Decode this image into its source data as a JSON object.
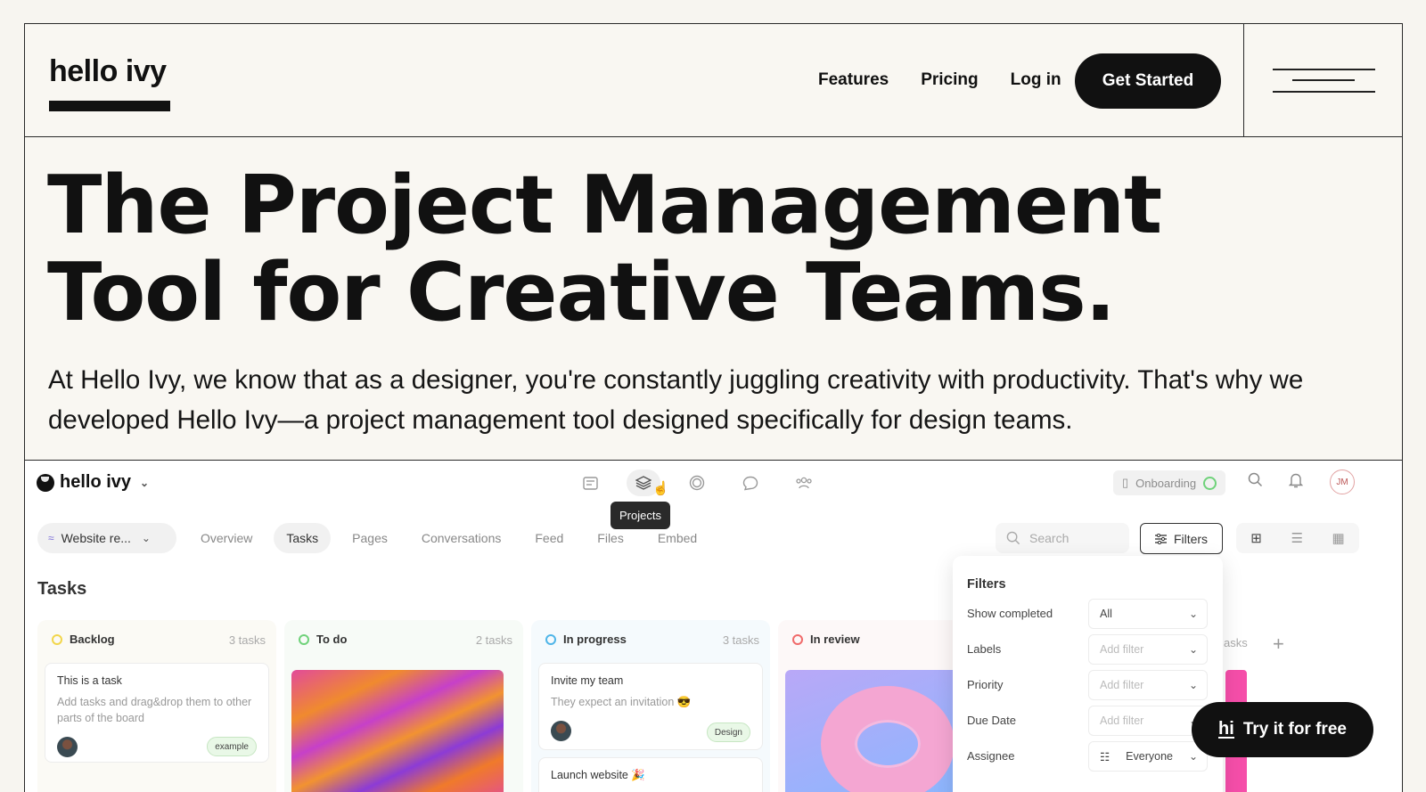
{
  "header": {
    "logo": "hello ivy",
    "nav": [
      "Features",
      "Pricing",
      "Log in"
    ],
    "cta": "Get Started"
  },
  "hero": {
    "title_line1": "The Project Management",
    "title_line2": "Tool for Creative Teams.",
    "lede": "At Hello Ivy, we know that as a designer, you're constantly juggling creativity with productivity. That's why we developed Hello Ivy—a project management tool designed specifically for design teams."
  },
  "app": {
    "logo": "hello ivy",
    "tooltip": "Projects",
    "onboarding": "Onboarding",
    "avatar_initials": "JM",
    "project": "Website re...",
    "tabs": [
      "Overview",
      "Tasks",
      "Pages",
      "Conversations",
      "Feed",
      "Files",
      "Embed"
    ],
    "active_tab": "Tasks",
    "search_placeholder": "Search",
    "filters_label": "Filters",
    "section_title": "Tasks",
    "columns": [
      {
        "name": "Backlog",
        "count": "3 tasks",
        "color": "#f2d64b"
      },
      {
        "name": "To do",
        "count": "2 tasks",
        "color": "#6fd27a"
      },
      {
        "name": "In progress",
        "count": "3 tasks",
        "color": "#4fb5e8"
      },
      {
        "name": "In review",
        "count": "",
        "color": "#f06a6a"
      }
    ],
    "cut_count": "asks",
    "cards": {
      "backlog": {
        "title": "This is a task",
        "desc": "Add tasks and drag&drop them to other parts of the board",
        "badge": "example"
      },
      "progress1": {
        "title": "Invite my team",
        "desc": "They expect an invitation 😎",
        "badge": "Design"
      },
      "progress2": {
        "title": "Launch website 🎉"
      }
    },
    "filter_panel": {
      "title": "Filters",
      "rows": [
        {
          "label": "Show completed",
          "value": "All",
          "has_value": true
        },
        {
          "label": "Labels",
          "value": "Add filter",
          "has_value": false
        },
        {
          "label": "Priority",
          "value": "Add filter",
          "has_value": false
        },
        {
          "label": "Due Date",
          "value": "Add filter",
          "has_value": false
        },
        {
          "label": "Assignee",
          "value": "Everyone",
          "has_value": true
        }
      ]
    }
  },
  "try_cta": {
    "mark": "hi",
    "label": "Try it for free"
  }
}
